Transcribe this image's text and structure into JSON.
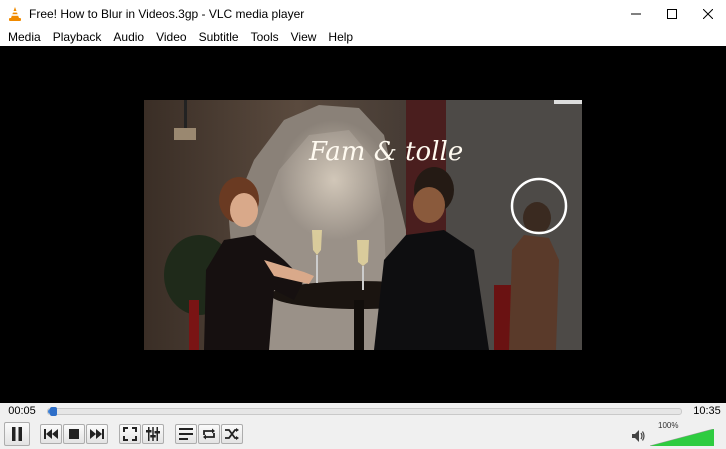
{
  "window": {
    "title": "Free! How to Blur in Videos.3gp - VLC media player",
    "app_icon": "vlc-cone-icon",
    "controls": [
      "minimize-icon",
      "maximize-icon",
      "close-icon"
    ]
  },
  "menu": {
    "items": [
      {
        "label": "Media"
      },
      {
        "label": "Playback"
      },
      {
        "label": "Audio"
      },
      {
        "label": "Video"
      },
      {
        "label": "Subtitle"
      },
      {
        "label": "Tools"
      },
      {
        "label": "View"
      },
      {
        "label": "Help"
      }
    ]
  },
  "neon_sign": "Fam & tolle",
  "playback": {
    "elapsed": "00:05",
    "total": "10:35",
    "progress_percent": 0.8
  },
  "controls": {
    "buttons": [
      "pause-icon",
      "previous-icon",
      "stop-icon",
      "next-icon",
      "fullscreen-icon",
      "extended-settings-icon",
      "playlist-icon",
      "loop-icon",
      "shuffle-icon"
    ]
  },
  "volume": {
    "label": "100%",
    "level_percent": 100,
    "accent": "#2ecc40"
  }
}
